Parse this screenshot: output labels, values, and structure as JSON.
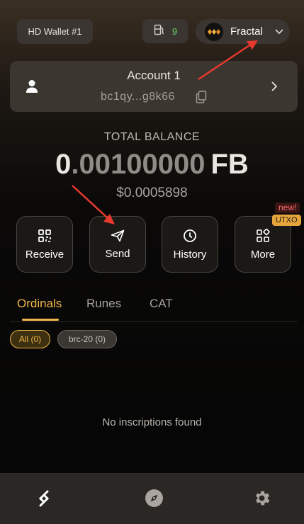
{
  "header": {
    "wallet_label": "HD Wallet #1",
    "gas_count": "9",
    "network_label": "Fractal",
    "icons": {
      "gas": "gas-pump-icon",
      "network": "fractal-logo-icon",
      "dropdown": "chevron-down-icon"
    }
  },
  "account": {
    "name": "Account 1",
    "address": "bc1qy...g8k66",
    "icons": {
      "user": "user-icon",
      "copy": "copy-icon",
      "open": "chevron-right-icon"
    }
  },
  "balance": {
    "label": "TOTAL BALANCE",
    "integer_part": "0",
    "decimal_part": ".00100000",
    "unit": "FB",
    "usd": "$0.0005898"
  },
  "actions": [
    {
      "label": "Receive",
      "icon": "qr-code-icon"
    },
    {
      "label": "Send",
      "icon": "send-icon"
    },
    {
      "label": "History",
      "icon": "clock-icon"
    },
    {
      "label": "More",
      "icon": "grid-icon"
    }
  ],
  "badges": {
    "new": "new!",
    "utxo": "UTXO"
  },
  "tabs": [
    {
      "label": "Ordinals",
      "active": true
    },
    {
      "label": "Runes",
      "active": false
    },
    {
      "label": "CAT",
      "active": false
    }
  ],
  "filters": [
    {
      "label": "All (0)",
      "active": true
    },
    {
      "label": "brc-20 (0)",
      "active": false
    }
  ],
  "empty_message": "No inscriptions found",
  "bottom_nav": [
    {
      "icon": "wallet-logo-icon",
      "active": true
    },
    {
      "icon": "compass-icon",
      "active": false
    },
    {
      "icon": "gear-icon",
      "active": false
    }
  ],
  "colors": {
    "accent": "#f0b64a",
    "gas_green": "#6bd36b",
    "annotation_red": "#e8392f",
    "badge_utxo": "#e6a53c",
    "badge_new_text": "#ff6b6b"
  }
}
